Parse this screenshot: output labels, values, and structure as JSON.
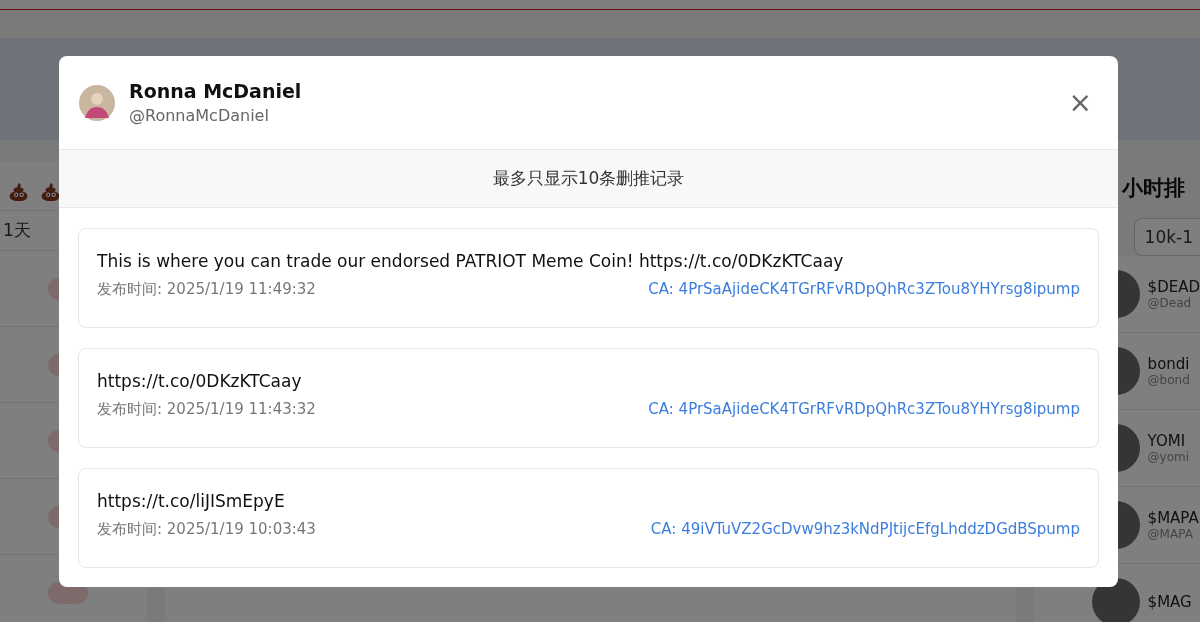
{
  "background": {
    "filter_tab": "1天",
    "ranking_title": "小时排",
    "range_field": "10k-1",
    "ranking": [
      {
        "name": "$DEAD",
        "handle": "@Dead"
      },
      {
        "name": "bondi",
        "handle": "@bond"
      },
      {
        "name": "YOMI",
        "handle": "@yomi"
      },
      {
        "name": "$MAPA",
        "handle": "@MAPA"
      },
      {
        "name": "$MAG"
      }
    ]
  },
  "modal": {
    "user": {
      "name": "Ronna McDaniel",
      "handle": "@RonnaMcDaniel"
    },
    "close": "×",
    "notice": "最多只显示10条删推记录",
    "tweets": [
      {
        "text": "This is where you can trade our endorsed PATRIOT Meme Coin! https://t.co/0DKzKTCaay",
        "time": "发布时间: 2025/1/19 11:49:32",
        "ca": "CA: 4PrSaAjideCK4TGrRFvRDpQhRc3ZTou8YHYrsg8ipump"
      },
      {
        "text": "https://t.co/0DKzKTCaay",
        "time": "发布时间: 2025/1/19 11:43:32",
        "ca": "CA: 4PrSaAjideCK4TGrRFvRDpQhRc3ZTou8YHYrsg8ipump"
      },
      {
        "text": "https://t.co/liJISmEpyE",
        "time": "发布时间: 2025/1/19 10:03:43",
        "ca": "CA: 49iVTuVZ2GcDvw9hz3kNdPJtijcEfgLhddzDGdBSpump"
      }
    ]
  }
}
